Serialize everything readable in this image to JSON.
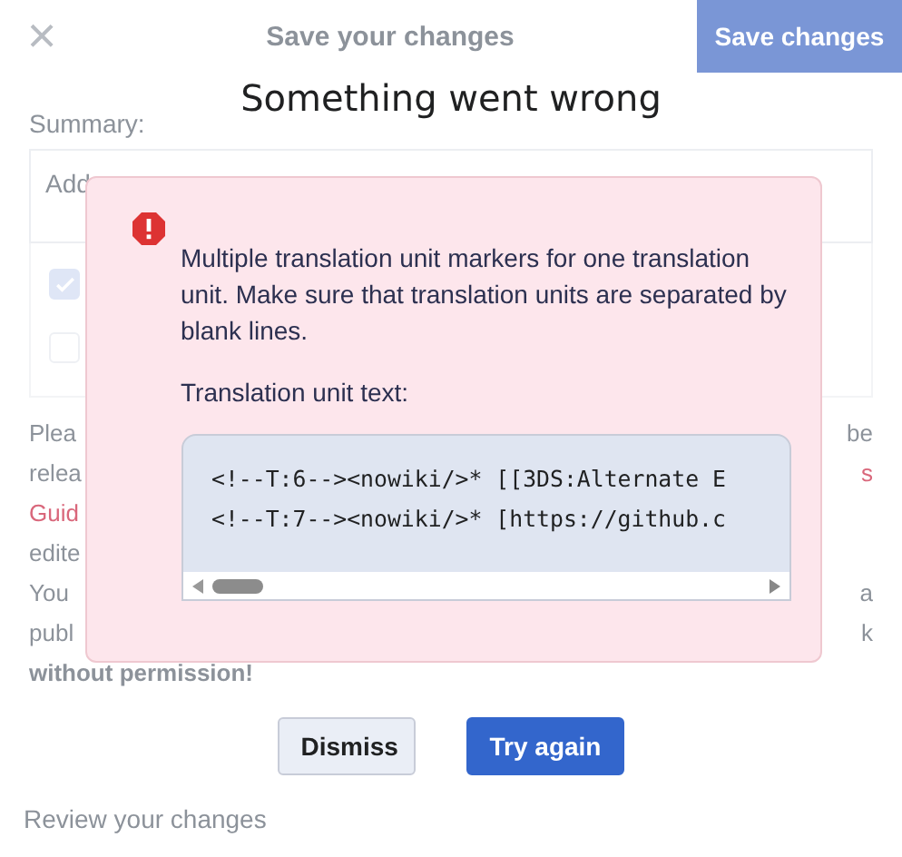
{
  "header": {
    "close": "×",
    "title": "Save your changes",
    "save_button": "Save changes"
  },
  "summary": {
    "label": "Summary:",
    "placeholder": "Add"
  },
  "options": [
    {
      "checked": true
    },
    {
      "checked": false
    }
  ],
  "notice_lines": [
    {
      "left": {
        "text": "Plea",
        "link": false
      },
      "right": {
        "text": "be",
        "link": false
      }
    },
    {
      "left": {
        "text": "relea",
        "link": false
      },
      "right": {
        "text": "s",
        "link": true
      }
    },
    {
      "left": {
        "text": "Guid",
        "link": true
      }
    },
    {
      "left": {
        "text": "edite",
        "link": false
      }
    },
    {
      "left": {
        "text": "You",
        "link": false
      },
      "right": {
        "text": "a",
        "link": false
      }
    },
    {
      "left": {
        "text": "publ",
        "link": false
      },
      "right": {
        "text": "k",
        "link": false
      }
    },
    {
      "left": {
        "text": "without permission!",
        "link": false,
        "bold": true
      }
    }
  ],
  "review_tab": "Review your changes",
  "dialog": {
    "title": "Something went wrong",
    "error": {
      "message": "Multiple translation unit markers for one translation unit. Make sure that translation units are separated by blank lines.",
      "code_label": "Translation unit text:",
      "code_lines": [
        "<!--T:6--><nowiki/>* [[3DS:Alternate E",
        "<!--T:7--><nowiki/>* [https://github.c"
      ]
    },
    "buttons": [
      {
        "label": "Dismiss",
        "kind": "secondary"
      },
      {
        "label": "Try again",
        "kind": "primary"
      }
    ]
  }
}
